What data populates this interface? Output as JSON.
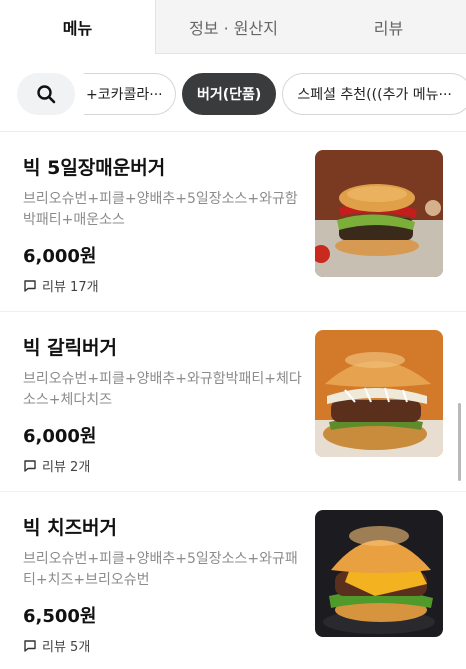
{
  "tabs": [
    {
      "label": "메뉴",
      "active": true
    },
    {
      "label": "정보 · 원산지",
      "active": false
    },
    {
      "label": "리뷰",
      "active": false
    }
  ],
  "filter": {
    "search_icon": "search-icon",
    "chips": [
      {
        "label": "+코카콜라···",
        "active": false
      },
      {
        "label": "버거(단품)",
        "active": true
      },
      {
        "label": "스페셜 추천(((추가 메뉴···",
        "active": false
      }
    ]
  },
  "menu": [
    {
      "name": "빅 5일장매운버거",
      "description": "브리오슈번+피클+양배추+5일장소스+와규함박패티+매운소스",
      "price": "6,000원",
      "review": "리뷰 17개"
    },
    {
      "name": "빅 갈릭버거",
      "description": "브리오슈번+피클+양배추+와규함박패티+체다소스+체다치즈",
      "price": "6,000원",
      "review": "리뷰 2개"
    },
    {
      "name": "빅 치즈버거",
      "description": "브리오슈번+피클+양배추+5일장소스+와규패티+치즈+브리오슈번",
      "price": "6,500원",
      "review": "리뷰 5개"
    }
  ],
  "colors": {
    "active_chip": "#3a3b3d",
    "muted_text": "#8c8c8c"
  }
}
